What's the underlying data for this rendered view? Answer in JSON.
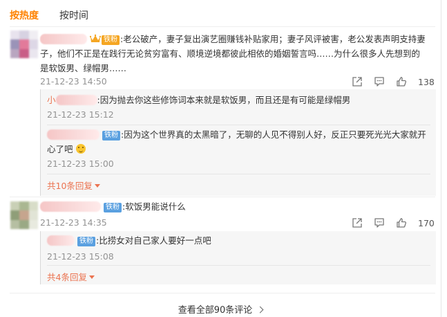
{
  "tabs": [
    {
      "label": "按热度",
      "active": true
    },
    {
      "label": "按时间",
      "active": false
    }
  ],
  "comments": [
    {
      "badge": "铁粉",
      "text": ":老公破产，妻子复出演艺圈赚钱补贴家用；妻子风评被害，老公发表声明支持妻子，他们不正是在践行无论贫穷富有、顺境逆境都彼此相依的婚姻誓言吗……为什么很多人先想到的是软饭男、绿帽男……",
      "time": "21-12-23 14:50",
      "likes": "138",
      "replies": [
        {
          "name_prefix": "小",
          "text": ":因为抛去你这些修饰词本来就是软饭男，而且还是有可能是绿帽男",
          "time": "21-12-23 15:12"
        },
        {
          "badge": "铁粉",
          "text": ":因为这个世界真的太黑暗了，无聊的人见不得别人好，反正只要死光光大家就开心了吧",
          "emoji": "smile-emoji",
          "time": "21-12-23 15:00"
        }
      ],
      "more_replies": "共10条回复"
    },
    {
      "badge": "铁粉",
      "text": ":软饭男能说什么",
      "time": "21-12-23 14:35",
      "likes": "170",
      "replies": [
        {
          "badge": "铁粉",
          "text": ":比捞女对自己家人要好一点吧",
          "time": "21-12-23 15:08"
        }
      ],
      "more_replies": "共4条回复"
    }
  ],
  "view_all": "查看全部90条评论",
  "colors": {
    "accent": "#ff8200",
    "link": "#eb7350",
    "fan_badge": "#5aa0e0",
    "vip_badge": "#f5a623"
  },
  "icons": [
    "share-icon",
    "comment-icon",
    "like-icon",
    "crown-icon",
    "caret-down-icon",
    "chevron-right-icon"
  ]
}
